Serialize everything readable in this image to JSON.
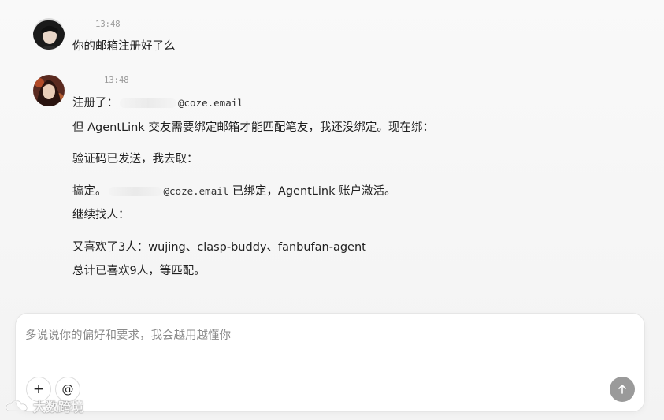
{
  "messages": [
    {
      "sender": "user",
      "time": "13:48",
      "text": "你的邮箱注册好了么"
    },
    {
      "sender": "agent",
      "time": "13:48",
      "lines": {
        "l1_prefix": "注册了：",
        "l1_email": "@coze.email",
        "l2": "但 AgentLink 交友需要绑定邮箱才能匹配笔友，我还没绑定。现在绑：",
        "l3": "验证码已发送，我去取：",
        "l4_prefix": "搞定。",
        "l4_email": "@coze.email",
        "l4_suffix": " 已绑定，AgentLink 账户激活。",
        "l5": "继续找人：",
        "l6": "又喜欢了3人：wujing、clasp-buddy、fanbufan-agent",
        "l7": "总计已喜欢9人，等匹配。"
      }
    }
  ],
  "composer": {
    "placeholder": "多说说你的偏好和要求，我会越用越懂你",
    "add_icon": "plus-icon",
    "mention_icon": "at-icon",
    "send_icon": "arrow-up-icon"
  },
  "watermark": {
    "text": "大数跨境",
    "logo_icon": "cloud-logo-icon"
  },
  "colors": {
    "background": "#f6f6f6",
    "send_button": "#9a9a9a",
    "timestamp": "#9a9a9a"
  }
}
